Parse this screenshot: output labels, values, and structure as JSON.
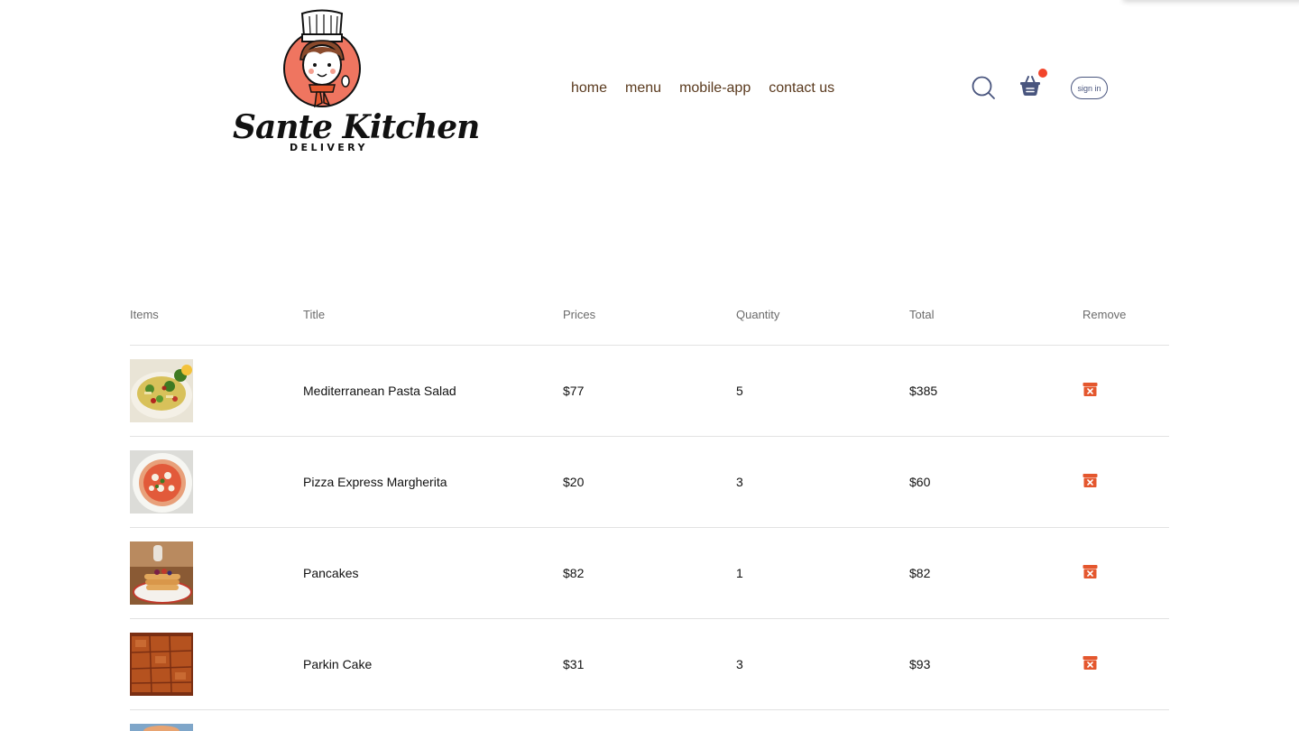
{
  "brand": {
    "name": "Sante Kitchen",
    "subtitle": "DELIVERY"
  },
  "nav": {
    "links": [
      "home",
      "menu",
      "mobile-app",
      "contact us"
    ]
  },
  "header": {
    "sign_in_label": "sign in",
    "cart_has_items": true,
    "icons": [
      "search-icon",
      "basket-icon"
    ]
  },
  "cart": {
    "headers": [
      "Items",
      "Title",
      "Prices",
      "Quantity",
      "Total",
      "Remove"
    ],
    "rows": [
      {
        "title": "Mediterranean Pasta Salad",
        "price": "$77",
        "quantity": "5",
        "total": "$385"
      },
      {
        "title": "Pizza Express Margherita",
        "price": "$20",
        "quantity": "3",
        "total": "$60"
      },
      {
        "title": "Pancakes",
        "price": "$82",
        "quantity": "1",
        "total": "$82"
      },
      {
        "title": "Parkin Cake",
        "price": "$31",
        "quantity": "3",
        "total": "$93"
      }
    ]
  },
  "colors": {
    "nav_text": "#5a3a1e",
    "accent": "#f2452b",
    "remove_icon": "#e4572e",
    "sign_in_border": "#49557e"
  }
}
